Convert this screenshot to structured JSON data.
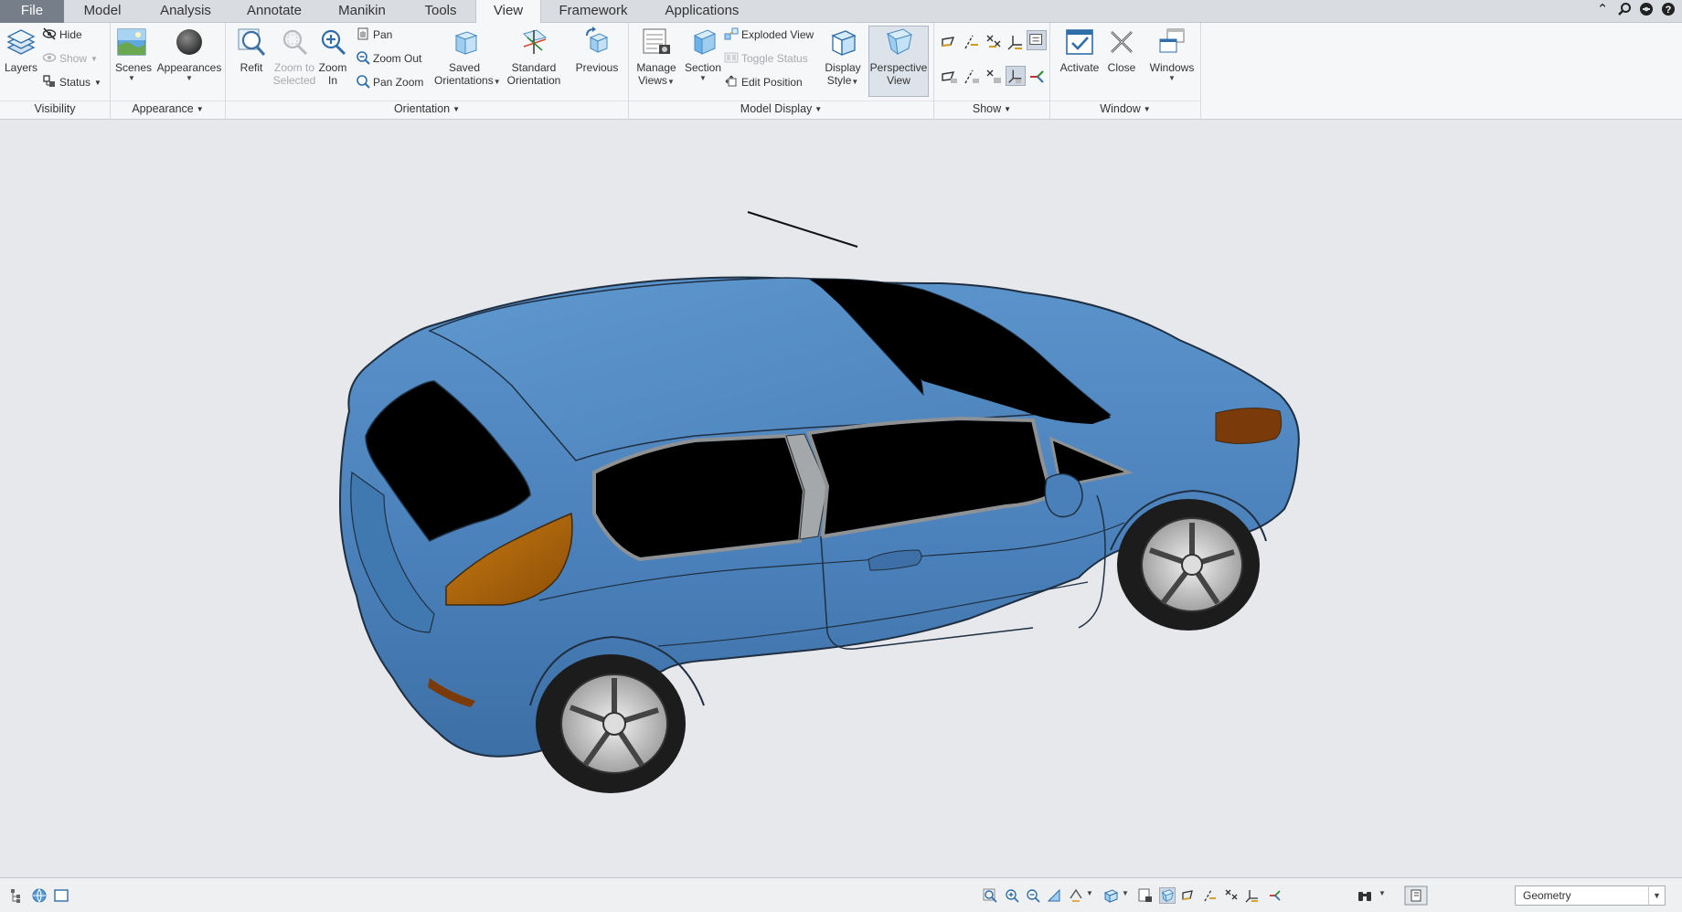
{
  "tabs": [
    {
      "label": "File"
    },
    {
      "label": "Model"
    },
    {
      "label": "Analysis"
    },
    {
      "label": "Annotate"
    },
    {
      "label": "Manikin"
    },
    {
      "label": "Tools"
    },
    {
      "label": "View",
      "active": true
    },
    {
      "label": "Framework"
    },
    {
      "label": "Applications"
    }
  ],
  "window_icons": [
    "chevron-up-icon",
    "search-icon",
    "collaboration-icon",
    "help-icon"
  ],
  "ribbon": {
    "visibility": {
      "label": "Visibility",
      "layers": "Layers",
      "hide": "Hide",
      "show": "Show",
      "status": "Status"
    },
    "appearance": {
      "label": "Appearance",
      "scenes": "Scenes",
      "appearances": "Appearances"
    },
    "orientation": {
      "label": "Orientation",
      "refit": "Refit",
      "zoom_to_selected_1": "Zoom to",
      "zoom_to_selected_2": "Selected",
      "zoom_in_1": "Zoom",
      "zoom_in_2": "In",
      "pan": "Pan",
      "zoom_out": "Zoom Out",
      "pan_zoom": "Pan Zoom",
      "saved_1": "Saved",
      "saved_2": "Orientations",
      "standard_1": "Standard",
      "standard_2": "Orientation",
      "previous": "Previous"
    },
    "model_display": {
      "label": "Model Display",
      "manage_1": "Manage",
      "manage_2": "Views",
      "section": "Section",
      "exploded_view": "Exploded View",
      "toggle_status": "Toggle Status",
      "edit_position": "Edit Position",
      "display_1": "Display",
      "display_2": "Style",
      "perspective_1": "Perspective",
      "perspective_2": "View"
    },
    "show": {
      "label": "Show"
    },
    "window": {
      "label": "Window",
      "activate": "Activate",
      "close": "Close",
      "windows": "Windows"
    }
  },
  "colors": {
    "car_body": "#4f86bf",
    "glass": "#000000",
    "tail_light": "#b8690a",
    "viewport_bg": "#e6e8ec",
    "file_tab": "#757e89"
  },
  "statusbar": {
    "filter_value": "Geometry"
  }
}
